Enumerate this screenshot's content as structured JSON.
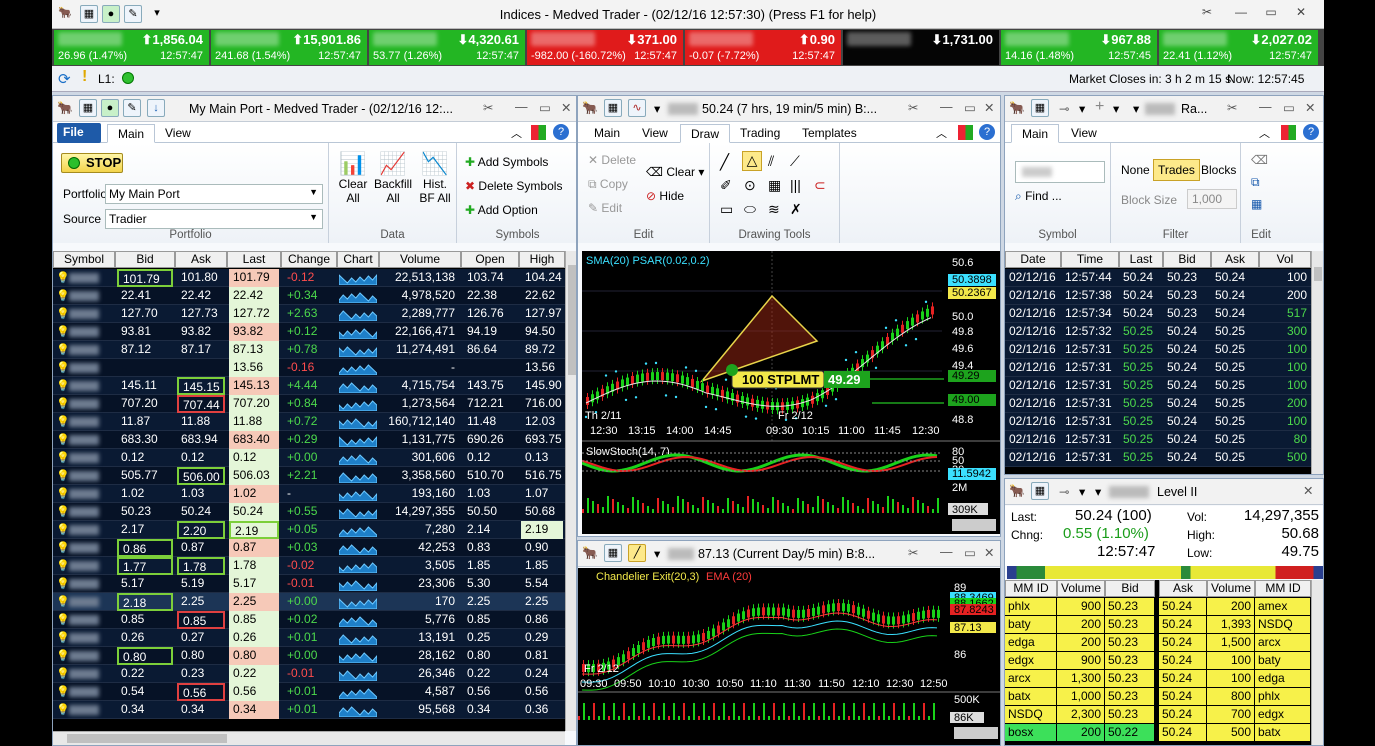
{
  "window_title": "Indices - Medved Trader - (02/12/16 12:57:30) (Press F1 for help)",
  "tickers": [
    {
      "price": "1,856.04",
      "dir": "up",
      "change": "26.96 (1.47%)",
      "time": "12:57:47",
      "color": "#23b623"
    },
    {
      "price": "15,901.86",
      "dir": "up",
      "change": "241.68 (1.54%)",
      "time": "12:57:47",
      "color": "#23b623"
    },
    {
      "price": "4,320.61",
      "dir": "down",
      "change": "53.77 (1.26%)",
      "time": "12:57:47",
      "color": "#23b623"
    },
    {
      "price": "371.00",
      "dir": "down",
      "change": "-982.00 (-160.72%)",
      "time": "12:57:47",
      "color": "#e01b1b"
    },
    {
      "price": "0.90",
      "dir": "up",
      "change": "-0.07 (-7.72%)",
      "time": "12:57:47",
      "color": "#e01b1b"
    },
    {
      "price": "1,731.00",
      "dir": "down",
      "change": "",
      "time": "",
      "color": "#050505"
    },
    {
      "price": "967.88",
      "dir": "down",
      "change": "14.16 (1.48%)",
      "time": "12:57:45",
      "color": "#23b623"
    },
    {
      "price": "2,027.02",
      "dir": "down",
      "change": "22.41 (1.12%)",
      "time": "12:57:47",
      "color": "#23b623"
    }
  ],
  "status": {
    "l1_label": "L1:",
    "market_closes": "Market Closes in: 3 h 2 m 15 s",
    "now": "Now:  12:57:45"
  },
  "portfolio": {
    "title": "My Main Port - Medved Trader - (02/12/16 12:...",
    "tabs": {
      "file": "File",
      "main": "Main",
      "view": "View"
    },
    "stop_label": "STOP",
    "portfolio_label": "Portfolio",
    "portfolio_value": "My Main Port",
    "source_label": "Source",
    "source_value": "Tradier",
    "group_portfolio": "Portfolio",
    "clear_all": "Clear All",
    "backfill_all": "Backfill All",
    "hist_bf_all": "Hist. BF All",
    "group_data": "Data",
    "add_symbols": "Add Symbols",
    "delete_symbols": "Delete Symbols",
    "add_option": "Add Option",
    "group_symbols": "Symbols",
    "columns": [
      "Symbol",
      "Bid",
      "Ask",
      "Last",
      "Change",
      "Chart",
      "Volume",
      "Open",
      "High"
    ],
    "rows": [
      [
        "101.79",
        "101.80",
        "101.79",
        "-0.12",
        "22,513,138",
        "103.74",
        "104.24"
      ],
      [
        "22.41",
        "22.42",
        "22.42",
        "+0.34",
        "4,978,520",
        "22.38",
        "22.62"
      ],
      [
        "127.70",
        "127.73",
        "127.72",
        "+2.63",
        "2,289,777",
        "126.76",
        "127.97"
      ],
      [
        "93.81",
        "93.82",
        "93.82",
        "+0.12",
        "22,166,471",
        "94.19",
        "94.50"
      ],
      [
        "87.12",
        "87.17",
        "87.13",
        "+0.78",
        "11,274,491",
        "86.64",
        "89.72"
      ],
      [
        "",
        "",
        "13.56",
        "-0.16",
        "-",
        "",
        "13.56"
      ],
      [
        "145.11",
        "145.15",
        "145.13",
        "+4.44",
        "4,715,754",
        "143.75",
        "145.90"
      ],
      [
        "707.20",
        "707.44",
        "707.20",
        "+0.84",
        "1,273,564",
        "712.21",
        "716.00"
      ],
      [
        "11.87",
        "11.88",
        "11.88",
        "+0.72",
        "160,712,140",
        "11.48",
        "12.03"
      ],
      [
        "683.30",
        "683.94",
        "683.40",
        "+0.29",
        "1,131,775",
        "690.26",
        "693.75"
      ],
      [
        "0.12",
        "0.12",
        "0.12",
        "+0.00",
        "301,606",
        "0.12",
        "0.13"
      ],
      [
        "505.77",
        "506.00",
        "506.03",
        "+2.21",
        "3,358,560",
        "510.70",
        "516.75"
      ],
      [
        "1.02",
        "1.03",
        "1.02",
        "-",
        "193,160",
        "1.03",
        "1.07"
      ],
      [
        "50.23",
        "50.24",
        "50.24",
        "+0.55",
        "14,297,355",
        "50.50",
        "50.68"
      ],
      [
        "2.17",
        "2.20",
        "2.19",
        "+0.05",
        "7,280",
        "2.14",
        "2.19"
      ],
      [
        "0.86",
        "0.87",
        "0.87",
        "+0.03",
        "42,253",
        "0.83",
        "0.90"
      ],
      [
        "1.77",
        "1.78",
        "1.78",
        "-0.02",
        "3,505",
        "1.85",
        "1.85"
      ],
      [
        "5.17",
        "5.19",
        "5.17",
        "-0.01",
        "23,306",
        "5.30",
        "5.54"
      ],
      [
        "2.18",
        "2.25",
        "2.25",
        "+0.00",
        "170",
        "2.25",
        "2.25"
      ],
      [
        "0.85",
        "0.85",
        "0.85",
        "+0.02",
        "5,776",
        "0.85",
        "0.86"
      ],
      [
        "0.26",
        "0.27",
        "0.26",
        "+0.01",
        "13,191",
        "0.25",
        "0.29"
      ],
      [
        "0.80",
        "0.80",
        "0.80",
        "+0.00",
        "28,162",
        "0.80",
        "0.81"
      ],
      [
        "0.22",
        "0.23",
        "0.22",
        "-0.01",
        "26,346",
        "0.22",
        "0.24"
      ],
      [
        "0.54",
        "0.56",
        "0.56",
        "+0.01",
        "4,587",
        "0.56",
        "0.56"
      ],
      [
        "0.34",
        "0.34",
        "0.34",
        "+0.01",
        "95,568",
        "0.34",
        "0.36"
      ]
    ]
  },
  "chart1": {
    "title": "50.24 (7 hrs, 19 min/5 min) B:...",
    "tabs": [
      "Main",
      "View",
      "Draw",
      "Trading",
      "Templates"
    ],
    "edit_delete": "Delete",
    "edit_copy": "Copy",
    "edit_edit": "Edit",
    "edit_clear": "Clear",
    "edit_hide": "Hide",
    "group_edit": "Edit",
    "group_drawing": "Drawing Tools",
    "indicator": "SMA(20) PSAR(0.02,0.2)",
    "order_label": "100 STPLMT",
    "order_price": "49.29",
    "price_labels": [
      "50.6",
      "50.3898",
      "50.2367",
      "50.0",
      "49.8",
      "49.6",
      "49.4",
      "49.29",
      "49.00",
      "48.8"
    ],
    "time_labels": [
      "12:30",
      "13:15",
      "14:00",
      "14:45",
      "09:30",
      "10:15",
      "11:00",
      "11:45",
      "12:30"
    ],
    "date_labels": [
      "Th 2/11",
      "Fr 2/12"
    ],
    "stoch_label": "SlowStoch(14, 7)",
    "stoch_values": [
      "80",
      "50",
      "20",
      "11.5942"
    ],
    "vol_labels": [
      "2M",
      "309K"
    ]
  },
  "chart2": {
    "title": "87.13 (Current Day/5 min) B:8...",
    "indicator_a": "Chandelier Exit(20,3)",
    "indicator_b": "EMA (20)",
    "price_labels": [
      "89",
      "88.3469",
      "88.1662",
      "87.8243",
      "87.13",
      "86"
    ],
    "date_label": "Fr 2/12",
    "time_labels": [
      "09:30",
      "09:50",
      "10:10",
      "10:30",
      "10:50",
      "11:10",
      "11:30",
      "11:50",
      "12:10",
      "12:30",
      "12:50"
    ],
    "vol_labels": [
      "500K",
      "86K"
    ]
  },
  "tas": {
    "title": "Ra...",
    "tabs": [
      "Main",
      "View"
    ],
    "find": "Find ...",
    "filter_none": "None",
    "filter_trades": "Trades",
    "filter_blocks": "Blocks",
    "block_size_label": "Block Size",
    "block_size": "1,000",
    "group_symbol": "Symbol",
    "group_filter": "Filter",
    "group_edit": "Edit",
    "columns": [
      "Date",
      "Time",
      "Last",
      "Bid",
      "Ask",
      "Vol"
    ],
    "rows": [
      [
        "02/12/16",
        "12:57:44",
        "50.24",
        "50.23",
        "50.24",
        "100"
      ],
      [
        "02/12/16",
        "12:57:38",
        "50.24",
        "50.23",
        "50.24",
        "200"
      ],
      [
        "02/12/16",
        "12:57:34",
        "50.24",
        "50.23",
        "50.24",
        "517"
      ],
      [
        "02/12/16",
        "12:57:32",
        "50.25",
        "50.24",
        "50.25",
        "300"
      ],
      [
        "02/12/16",
        "12:57:31",
        "50.25",
        "50.24",
        "50.25",
        "100"
      ],
      [
        "02/12/16",
        "12:57:31",
        "50.25",
        "50.24",
        "50.25",
        "100"
      ],
      [
        "02/12/16",
        "12:57:31",
        "50.25",
        "50.24",
        "50.25",
        "100"
      ],
      [
        "02/12/16",
        "12:57:31",
        "50.25",
        "50.24",
        "50.25",
        "200"
      ],
      [
        "02/12/16",
        "12:57:31",
        "50.25",
        "50.24",
        "50.25",
        "100"
      ],
      [
        "02/12/16",
        "12:57:31",
        "50.25",
        "50.24",
        "50.25",
        "80"
      ],
      [
        "02/12/16",
        "12:57:31",
        "50.25",
        "50.24",
        "50.25",
        "500"
      ]
    ]
  },
  "level2": {
    "title": "Level II",
    "last_label": "Last:",
    "last": "50.24 (100)",
    "chng_label": "Chng:",
    "chng": "0.55 (1.10%)",
    "time": "12:57:47",
    "vol_label": "Vol:",
    "vol": "14,297,355",
    "high_label": "High:",
    "high": "50.68",
    "low_label": "Low:",
    "low": "49.75",
    "columns": [
      "MM ID",
      "Volume",
      "Bid",
      "Ask",
      "Volume",
      "MM ID"
    ],
    "rows": [
      [
        "phlx",
        "900",
        "50.23",
        "50.24",
        "200",
        "amex"
      ],
      [
        "baty",
        "200",
        "50.23",
        "50.24",
        "1,393",
        "NSDQ"
      ],
      [
        "edga",
        "200",
        "50.23",
        "50.24",
        "1,500",
        "arcx"
      ],
      [
        "edgx",
        "900",
        "50.23",
        "50.24",
        "100",
        "baty"
      ],
      [
        "arcx",
        "1,300",
        "50.23",
        "50.24",
        "100",
        "edga"
      ],
      [
        "batx",
        "1,000",
        "50.23",
        "50.24",
        "800",
        "phlx"
      ],
      [
        "NSDQ",
        "2,300",
        "50.23",
        "50.24",
        "700",
        "edgx"
      ],
      [
        "bosx",
        "200",
        "50.22",
        "50.24",
        "500",
        "batx"
      ]
    ]
  }
}
